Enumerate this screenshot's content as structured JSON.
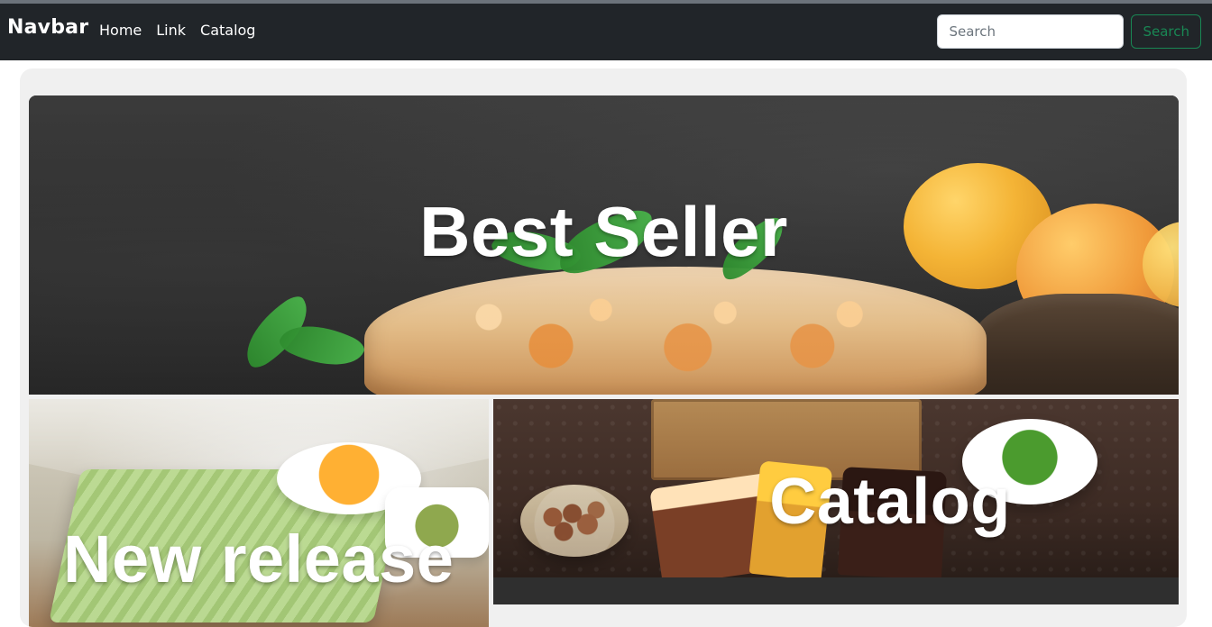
{
  "navbar": {
    "brand": "Navbar",
    "links": [
      {
        "label": "Home"
      },
      {
        "label": "Link"
      },
      {
        "label": "Catalog"
      }
    ],
    "search": {
      "placeholder": "Search",
      "button_label": "Search"
    }
  },
  "tiles": {
    "best_seller": {
      "label": "Best Seller"
    },
    "new_release": {
      "label": "New release"
    },
    "catalog": {
      "label": "Catalog"
    }
  },
  "colors": {
    "navbar_bg": "#212529",
    "search_button": "#198754",
    "panel_bg": "#f0f0f0"
  }
}
